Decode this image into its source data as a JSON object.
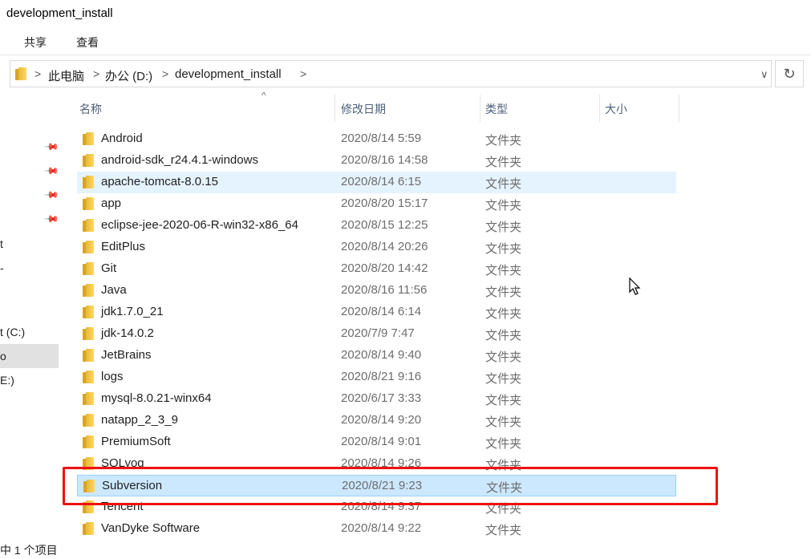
{
  "window": {
    "title": "development_install"
  },
  "ribbon": {
    "tabs": [
      "共享",
      "查看"
    ]
  },
  "address": {
    "crumbs": [
      "此电脑",
      "办公 (D:)",
      "development_install"
    ],
    "separator": ">",
    "dropdown_icon": "chevron-down-icon",
    "refresh_icon": "refresh-icon",
    "refresh_glyph": "↻",
    "dropdown_glyph": "∨"
  },
  "nav": {
    "pin_glyph": "📌",
    "items": [
      "t",
      "-",
      "t (C:)",
      "o",
      "E:)"
    ]
  },
  "columns": {
    "name": "名称",
    "modified": "修改日期",
    "type": "类型",
    "size": "大小"
  },
  "sort_glyph": "^",
  "files": [
    {
      "name": "Android",
      "modified": "2020/8/14 5:59",
      "type": "文件夹"
    },
    {
      "name": "android-sdk_r24.4.1-windows",
      "modified": "2020/8/16 14:58",
      "type": "文件夹"
    },
    {
      "name": "apache-tomcat-8.0.15",
      "modified": "2020/8/14 6:15",
      "type": "文件夹"
    },
    {
      "name": "app",
      "modified": "2020/8/20 15:17",
      "type": "文件夹"
    },
    {
      "name": "eclipse-jee-2020-06-R-win32-x86_64",
      "modified": "2020/8/15 12:25",
      "type": "文件夹"
    },
    {
      "name": "EditPlus",
      "modified": "2020/8/14 20:26",
      "type": "文件夹"
    },
    {
      "name": "Git",
      "modified": "2020/8/20 14:42",
      "type": "文件夹"
    },
    {
      "name": "Java",
      "modified": "2020/8/16 11:56",
      "type": "文件夹"
    },
    {
      "name": "jdk1.7.0_21",
      "modified": "2020/8/14 6:14",
      "type": "文件夹"
    },
    {
      "name": "jdk-14.0.2",
      "modified": "2020/7/9 7:47",
      "type": "文件夹"
    },
    {
      "name": "JetBrains",
      "modified": "2020/8/14 9:40",
      "type": "文件夹"
    },
    {
      "name": "logs",
      "modified": "2020/8/21 9:16",
      "type": "文件夹"
    },
    {
      "name": "mysql-8.0.21-winx64",
      "modified": "2020/6/17 3:33",
      "type": "文件夹"
    },
    {
      "name": "natapp_2_3_9",
      "modified": "2020/8/14 9:20",
      "type": "文件夹"
    },
    {
      "name": "PremiumSoft",
      "modified": "2020/8/14 9:01",
      "type": "文件夹"
    },
    {
      "name": "SQLyog",
      "modified": "2020/8/14 9:26",
      "type": "文件夹"
    },
    {
      "name": "Subversion",
      "modified": "2020/8/21 9:23",
      "type": "文件夹"
    },
    {
      "name": "Tencent",
      "modified": "2020/8/14 9:37",
      "type": "文件夹"
    },
    {
      "name": "VanDyke Software",
      "modified": "2020/8/14 9:22",
      "type": "文件夹"
    }
  ],
  "hover_row": 2,
  "selected_row": 16,
  "status": {
    "text": "中 1 个项目"
  },
  "colors": {
    "selected_bg": "#cce8ff",
    "hover_bg": "#e5f3ff",
    "highlight_border": "#ee1111",
    "folder": "#ffd767"
  }
}
